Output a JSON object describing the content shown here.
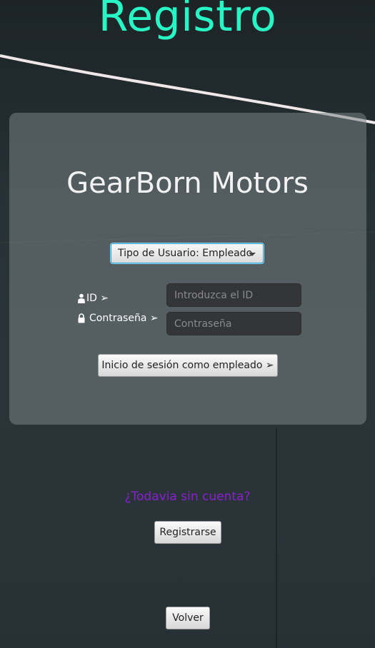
{
  "header": {
    "title": "Registro"
  },
  "card": {
    "brand": "GearBorn Motors",
    "user_type_select": {
      "value": "Tipo de Usuario: Empleado"
    },
    "id_label": "ID ➢",
    "password_label": "Contraseña ➢",
    "id_input": {
      "placeholder": "Introduzca el ID",
      "value": ""
    },
    "password_input": {
      "placeholder": "Contraseña",
      "value": ""
    },
    "login_button": "Inicio de sesión como empleado ➢"
  },
  "register": {
    "prompt": "¿Todavia sin cuenta?",
    "button": "Registrarse"
  },
  "back_button": "Volver",
  "colors": {
    "title": "#27f5c6",
    "link": "#8a1fd0",
    "select_focus": "#2fa7d8"
  },
  "icons": {
    "id_label": "person-icon",
    "password_label": "lock-icon",
    "select": "chevron-down-icon"
  }
}
